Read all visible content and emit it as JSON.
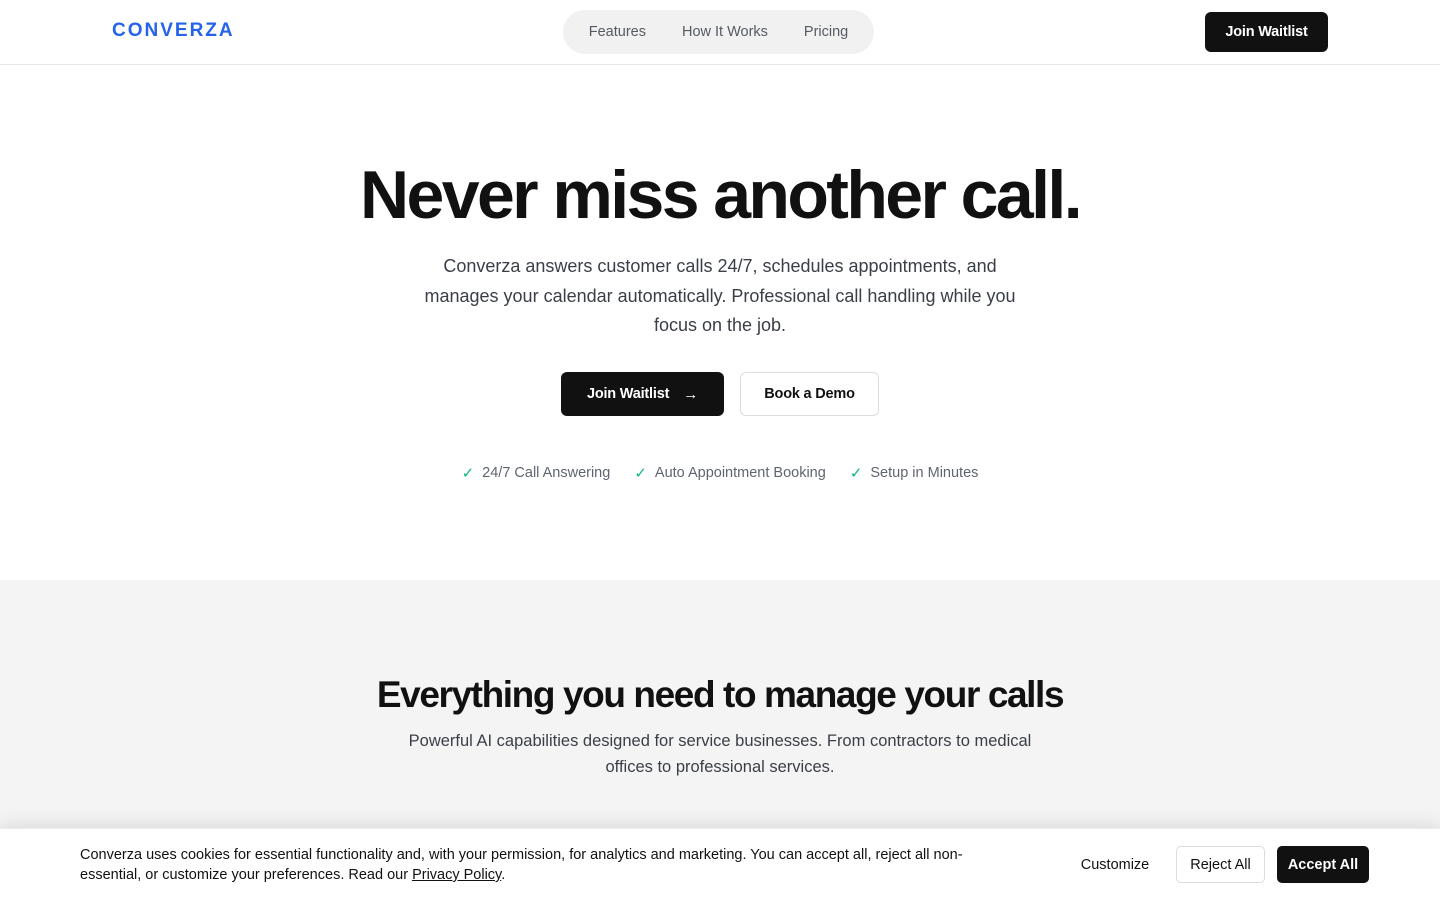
{
  "header": {
    "logo": "CONVERZA",
    "nav": [
      {
        "label": "Features"
      },
      {
        "label": "How It Works"
      },
      {
        "label": "Pricing"
      }
    ],
    "cta_label": "Join Waitlist"
  },
  "hero": {
    "title": "Never miss another call.",
    "subtitle": "Converza answers customer calls 24/7, schedules appointments, and manages your calendar automatically. Professional call handling while you focus on the job.",
    "primary_label": "Join Waitlist",
    "primary_icon": "arrow-right-icon",
    "secondary_label": "Book a Demo",
    "checks": [
      {
        "label": "24/7 Call Answering"
      },
      {
        "label": "Auto Appointment Booking"
      },
      {
        "label": "Setup in Minutes"
      }
    ]
  },
  "features": {
    "title": "Everything you need to manage your calls",
    "subtitle": "Powerful AI capabilities designed for service businesses. From contractors to medical offices to professional services."
  },
  "cookie": {
    "text": "Converza uses cookies for essential functionality and, with your permission, for analytics and marketing. You can accept all, reject all non-essential, or customize your preferences. Read our ",
    "policy_link": "Privacy Policy",
    "text_end": ".",
    "customize_label": "Customize",
    "reject_label": "Reject All",
    "accept_label": "Accept All"
  },
  "colors": {
    "brand": "#2563eb",
    "primary": "#111111",
    "check": "#10b981",
    "section_bg": "#f4f4f4"
  }
}
